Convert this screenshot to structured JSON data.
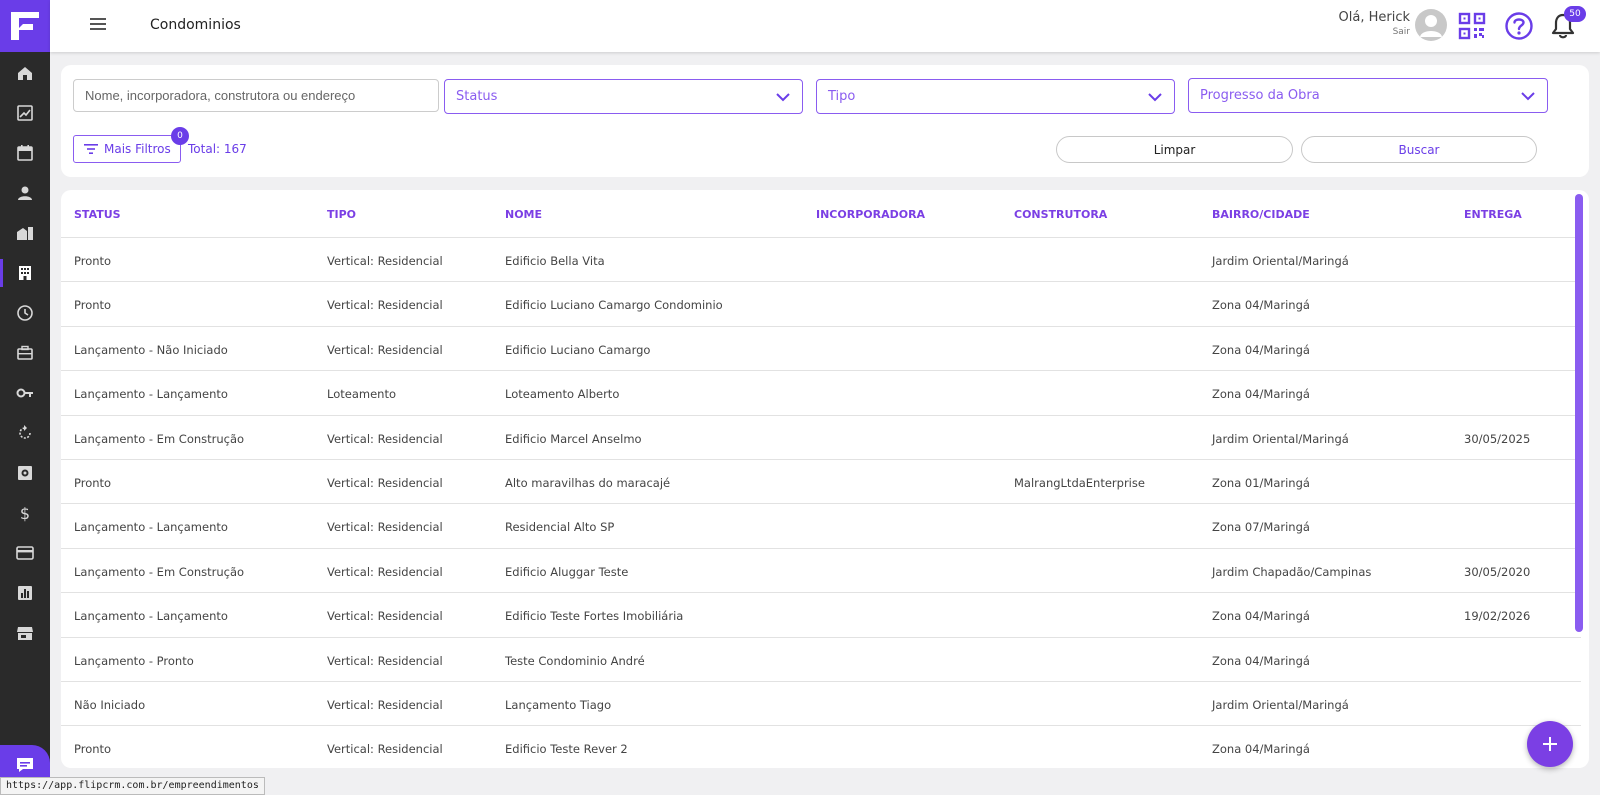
{
  "app": {
    "accent_color": "#6a3de8",
    "page_title": "Condominios"
  },
  "header": {
    "greeting": "Olá, Herick",
    "logout": "Sair",
    "notifications_count": "50"
  },
  "sidebar": {
    "items": [
      {
        "icon": "home-icon"
      },
      {
        "icon": "trending-chart-icon"
      },
      {
        "icon": "calendar-icon"
      },
      {
        "icon": "person-icon"
      },
      {
        "icon": "buildings-icon"
      },
      {
        "icon": "condominium-icon",
        "active": true
      },
      {
        "icon": "clock-icon"
      },
      {
        "icon": "briefcase-icon"
      },
      {
        "icon": "key-icon"
      },
      {
        "icon": "refresh-icon"
      },
      {
        "icon": "vault-icon"
      },
      {
        "icon": "dollar-icon"
      },
      {
        "icon": "credit-card-icon"
      },
      {
        "icon": "bar-report-icon"
      },
      {
        "icon": "store-icon"
      }
    ]
  },
  "filters": {
    "search_placeholder": "Nome, incorporadora, construtora ou endereço",
    "status_label": "Status",
    "tipo_label": "Tipo",
    "progresso_label": "Progresso da Obra",
    "more_filters_label": "Mais Filtros",
    "more_filters_count": "0",
    "total_label": "Total: 167",
    "clear_label": "Limpar",
    "search_label": "Buscar"
  },
  "table": {
    "columns": [
      "STATUS",
      "TIPO",
      "NOME",
      "INCORPORADORA",
      "CONSTRUTORA",
      "BAIRRO/CIDADE",
      "ENTREGA"
    ],
    "rows": [
      [
        "Pronto",
        "Vertical: Residencial",
        "Edificio Bella Vita",
        "",
        "",
        "Jardim Oriental/Maringá",
        ""
      ],
      [
        "Pronto",
        "Vertical: Residencial",
        "Edificio Luciano Camargo Condominio",
        "",
        "",
        "Zona 04/Maringá",
        ""
      ],
      [
        "Lançamento - Não Iniciado",
        "Vertical: Residencial",
        "Edificio Luciano Camargo",
        "",
        "",
        "Zona 04/Maringá",
        ""
      ],
      [
        "Lançamento - Lançamento",
        "Loteamento",
        "Loteamento Alberto",
        "",
        "",
        "Zona 04/Maringá",
        ""
      ],
      [
        "Lançamento - Em Construção",
        "Vertical: Residencial",
        "Edificio Marcel Anselmo",
        "",
        "",
        "Jardim Oriental/Maringá",
        "30/05/2025"
      ],
      [
        "Pronto",
        "Vertical: Residencial",
        "Alto maravilhas do maracajé",
        "",
        "MalrangLtdaEnterprise",
        "Zona 01/Maringá",
        ""
      ],
      [
        "Lançamento - Lançamento",
        "Vertical: Residencial",
        "Residencial Alto SP",
        "",
        "",
        "Zona 07/Maringá",
        ""
      ],
      [
        "Lançamento - Em Construção",
        "Vertical: Residencial",
        "Edificio Aluggar Teste",
        "",
        "",
        "Jardim Chapadão/Campinas",
        "30/05/2020"
      ],
      [
        "Lançamento - Lançamento",
        "Vertical: Residencial",
        "Edificio Teste Fortes Imobiliária",
        "",
        "",
        "Zona 04/Maringá",
        "19/02/2026"
      ],
      [
        "Lançamento - Pronto",
        "Vertical: Residencial",
        "Teste Condominio André",
        "",
        "",
        "Zona 04/Maringá",
        ""
      ],
      [
        "Não Iniciado",
        "Vertical: Residencial",
        "Lançamento Tiago",
        "",
        "",
        "Jardim Oriental/Maringá",
        ""
      ],
      [
        "Pronto",
        "Vertical: Residencial",
        "Edificio Teste Rever 2",
        "",
        "",
        "Zona 04/Maringá",
        ""
      ]
    ]
  },
  "status_url": "https://app.flipcrm.com.br/empreendimentos"
}
